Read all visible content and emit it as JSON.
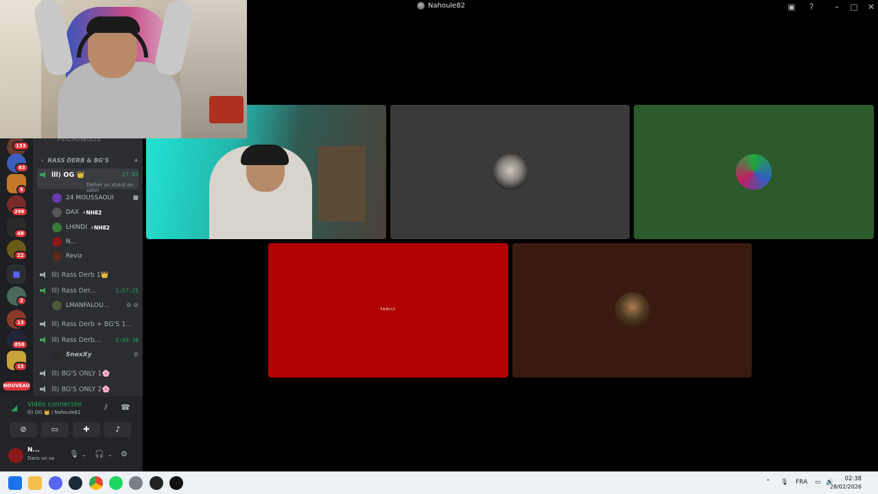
{
  "window": {
    "title": "Nahoule82"
  },
  "servers": [
    {
      "badge": "133"
    },
    {
      "badge": "83"
    },
    {
      "badge": "5"
    },
    {
      "badge": "296"
    },
    {
      "badge": "48"
    },
    {
      "badge": "22"
    },
    {
      "badge": ""
    },
    {
      "badge": "2"
    },
    {
      "badge": "13"
    },
    {
      "badge": "858"
    },
    {
      "badge": "15"
    }
  ],
  "new_badge": "NOUVEAU",
  "channels": {
    "partial_top": "PSYCHOSKULLS",
    "category": "RASS DERB & BG'S",
    "active": {
      "name": "lll⟩ OG 👑",
      "timer": "27:05",
      "status": "Définir un statut de salon"
    },
    "active_members": [
      {
        "name": "24 MOUSSAOUI",
        "tag": ""
      },
      {
        "name": "DAX",
        "tag": "⚡NH82"
      },
      {
        "name": "LHINDI",
        "tag": "⚡NH82"
      },
      {
        "name": "N...",
        "tag": ""
      },
      {
        "name": "Reviz",
        "tag": ""
      }
    ],
    "voice": [
      {
        "name": "lll⟩ Rass Derb 1👑",
        "timer": ""
      },
      {
        "name": "lll⟩ Rass Der...",
        "timer": "1:57:25"
      },
      {
        "name": "LMANFALOU...",
        "timer": "",
        "member": true
      },
      {
        "name": "lll⟩ Rass Derb + BG'S 1...",
        "timer": ""
      },
      {
        "name": "lll⟩ Rass Derb...",
        "timer": "2:09:38"
      },
      {
        "name": "SnexXy",
        "timer": "",
        "member": true
      },
      {
        "name": "lll⟩ BG'S ONLY 1🌸",
        "timer": ""
      },
      {
        "name": "lll⟩ BG'S ONLY 2🌸",
        "timer": ""
      }
    ]
  },
  "voice_panel": {
    "connected_label": "Vidéo connectée",
    "path": "lll⟩ OG 👑 / Nahoule82",
    "buttons": [
      "camera-off-icon",
      "screen-share-icon",
      "activities-icon",
      "soundboard-icon"
    ]
  },
  "user": {
    "name": "N...",
    "status": "Dans un sa"
  },
  "tiles": [
    {
      "kind": "camera",
      "color": "#1fd3c4"
    },
    {
      "kind": "avatar",
      "color": "#3a3a3a"
    },
    {
      "kind": "avatar",
      "color": "#2d5a2d"
    },
    {
      "kind": "avatar",
      "color": "#b00000",
      "label": "FAMILY"
    },
    {
      "kind": "avatar",
      "color": "#3a1a10"
    }
  ],
  "taskbar": {
    "lang": "FRA",
    "time": "02:38",
    "date": "28/02/2026"
  }
}
